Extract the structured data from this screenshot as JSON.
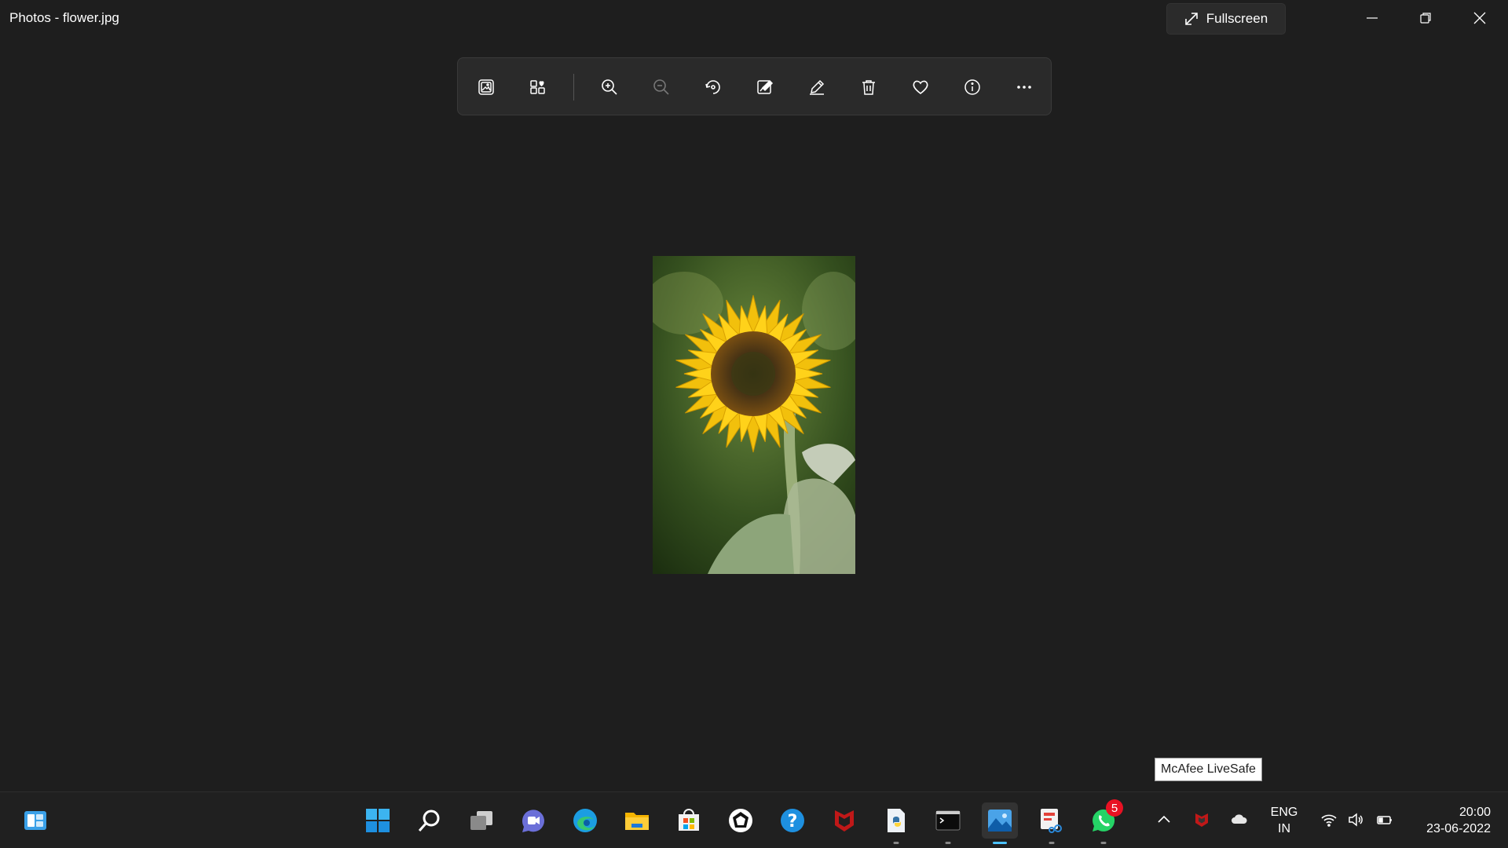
{
  "window": {
    "title": "Photos - flower.jpg",
    "fullscreen_label": "Fullscreen"
  },
  "toolbar": {
    "buttons": [
      "view-image-icon",
      "albums-icon",
      "zoom-in-icon",
      "zoom-out-icon",
      "rotate-icon",
      "edit-image-icon",
      "draw-icon",
      "delete-icon",
      "favorite-icon",
      "info-icon",
      "more-icon"
    ]
  },
  "image": {
    "name": "flower.jpg",
    "subject": "sunflower"
  },
  "taskbar": {
    "apps": [
      "widgets-icon",
      "start-icon",
      "search-icon",
      "task-view-icon",
      "chat-icon",
      "edge-icon",
      "file-explorer-icon",
      "store-icon",
      "unknown-app-icon",
      "help-icon",
      "mcafee-icon",
      "python-icon",
      "terminal-icon",
      "photos-icon",
      "snipping-tool-icon",
      "whatsapp-icon"
    ],
    "whatsapp_badge": "5",
    "language_line1": "ENG",
    "language_line2": "IN",
    "time": "20:00",
    "date": "23-06-2022",
    "tooltip": "McAfee LiveSafe"
  },
  "colors": {
    "background": "#1e1e1e",
    "taskbar": "#202020",
    "accent": "#4cc2ff",
    "mcafee_red": "#c01818",
    "badge_red": "#e81123"
  }
}
